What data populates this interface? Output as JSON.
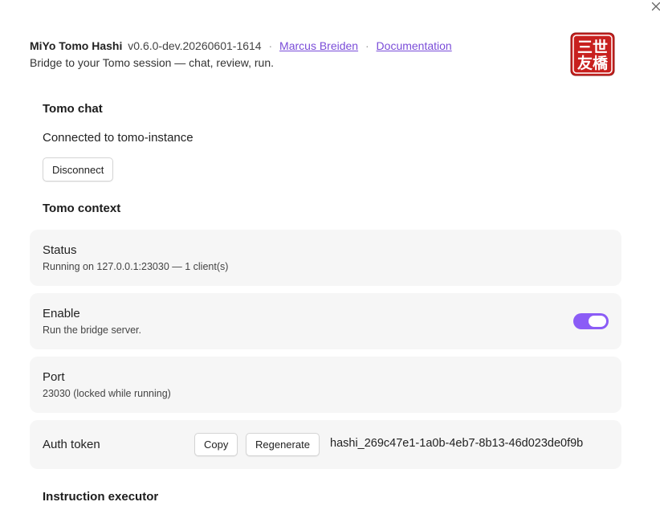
{
  "header": {
    "app_name": "MiYo Tomo Hashi",
    "version": "v0.6.0-dev.20260601-1614",
    "separator": "·",
    "author_link": "Marcus Breiden",
    "docs_link": "Documentation",
    "subtitle": "Bridge to your Tomo session — chat, review, run.",
    "logo_text": [
      "三世",
      "友橋"
    ]
  },
  "tomo_chat": {
    "heading": "Tomo chat",
    "connection_text": "Connected to tomo-instance",
    "disconnect_label": "Disconnect"
  },
  "tomo_context": {
    "heading": "Tomo context",
    "status": {
      "title": "Status",
      "description": "Running on 127.0.0.1:23030 — 1 client(s)"
    },
    "enable": {
      "title": "Enable",
      "description": "Run the bridge server.",
      "enabled": true
    },
    "port": {
      "title": "Port",
      "description": "23030 (locked while running)"
    },
    "auth_token": {
      "title": "Auth token",
      "copy_label": "Copy",
      "regenerate_label": "Regenerate",
      "value": "hashi_269c47e1-1a0b-4eb7-8b13-46d023de0f9b"
    }
  },
  "instruction_executor": {
    "heading": "Instruction executor"
  },
  "colors": {
    "accent": "#8b5cf6",
    "link": "#7a4cd8",
    "card_background": "#f6f6f6",
    "logo_red": "#c8201e"
  },
  "icons": {
    "close": "close-icon"
  }
}
